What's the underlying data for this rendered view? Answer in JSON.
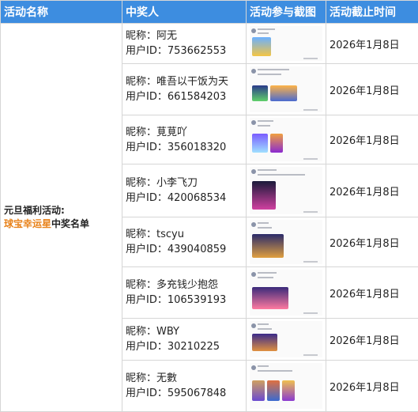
{
  "headers": {
    "activity_name": "活动名称",
    "winner": "中奖人",
    "screenshot": "活动参与截图",
    "deadline": "活动截止时间"
  },
  "activity": {
    "line1": "元旦福利活动:",
    "highlight": "球宝幸运星",
    "suffix": "中奖名单"
  },
  "colors": {
    "header_bg": "#3d8de0",
    "highlight": "#e8821a"
  },
  "rows": [
    {
      "nickname": "昵称：阿无",
      "uid": "用户ID：753662553",
      "deadline": "2026年1月8日"
    },
    {
      "nickname": "昵称：唯吾以干饭为天",
      "uid": "用户ID：661584203",
      "deadline": "2026年1月8日"
    },
    {
      "nickname": "昵称：莧莧吖",
      "uid": "用户ID：356018320",
      "deadline": "2026年1月8日"
    },
    {
      "nickname": "昵称：小李飞刀",
      "uid": "用户ID：420068534",
      "deadline": "2026年1月8日"
    },
    {
      "nickname": "昵称：tscyu",
      "uid": "用户ID：439040859",
      "deadline": "2026年1月8日"
    },
    {
      "nickname": "昵称：多充钱少抱怨",
      "uid": "用户ID：106539193",
      "deadline": "2026年1月8日"
    },
    {
      "nickname": "昵称：WBY",
      "uid": "用户ID：30210225",
      "deadline": "2026年1月8日"
    },
    {
      "nickname": "昵称：无數",
      "uid": "用户ID：595067848",
      "deadline": "2026年1月8日"
    }
  ]
}
